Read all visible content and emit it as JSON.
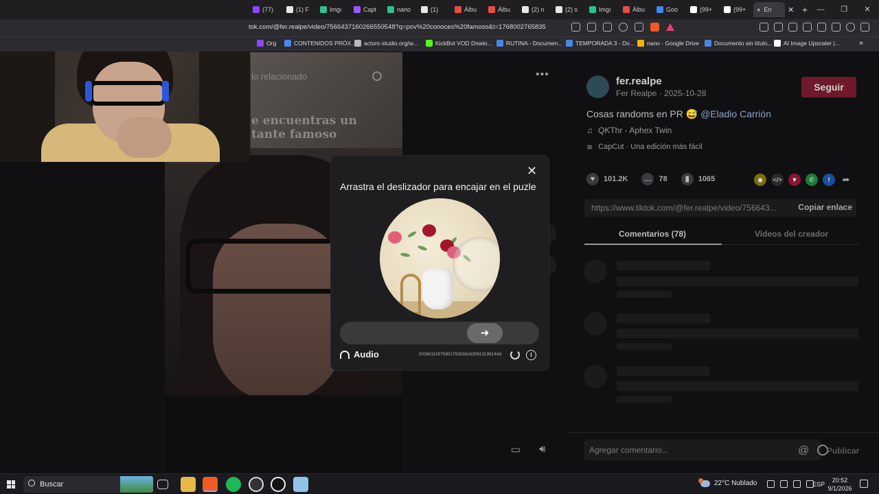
{
  "browser": {
    "tabs": [
      {
        "label": "(77)",
        "color": "#8e44ff"
      },
      {
        "label": "(1) F",
        "color": "#e8e8e8"
      },
      {
        "label": "Imgı",
        "color": "#2fbf8f"
      },
      {
        "label": "Capt",
        "color": "#9b59ff"
      },
      {
        "label": "nano",
        "color": "#2fbf8f"
      },
      {
        "label": "(1)  ",
        "color": "#e8e8e8"
      },
      {
        "label": "Álbu",
        "color": "#e94c3d"
      },
      {
        "label": "Álbu",
        "color": "#e94c3d"
      },
      {
        "label": "(2) n",
        "color": "#e8e8e8"
      },
      {
        "label": "(2) s",
        "color": "#e8e8e8"
      },
      {
        "label": "Imgı",
        "color": "#2fbf8f"
      },
      {
        "label": "Álbu",
        "color": "#e94c3d"
      },
      {
        "label": "Goo",
        "color": "#4285f4"
      },
      {
        "label": "(99+",
        "color": "#ffffff"
      },
      {
        "label": "(99+",
        "color": "#ffffff"
      }
    ],
    "active_tab": "En",
    "url": "tok.com/@fer.realpe/video/7566437160266550548?q=pov%20conoces%20famoso&t=1768002765835",
    "bookmarks": [
      {
        "label": "Org",
        "color": "#8e44ff"
      },
      {
        "label": "CONTENIDOS PRÓX...",
        "color": "#4a86e8"
      },
      {
        "label": "actors-studio.org/w...",
        "color": "#bbbbbb"
      },
      {
        "label": "KickBot VOD Dowlo...",
        "color": "#53fc18"
      },
      {
        "label": "RUTINA - Documen...",
        "color": "#4a86e8"
      },
      {
        "label": "TEMPORADA 3 - Do...",
        "color": "#4a86e8"
      },
      {
        "label": "nano - Google Drive",
        "color": "#f4b400"
      },
      {
        "label": "Documento sin título...",
        "color": "#4a86e8"
      },
      {
        "label": "AI Image Upscaler |...",
        "color": "#ffffff"
      }
    ]
  },
  "video": {
    "related_label": "lo relacionado",
    "overlay_text_1": "e encuentras un",
    "overlay_text_2": "tante famoso"
  },
  "creator": {
    "username": "fer.realpe",
    "meta": "Fer Realpe · 2025-10-28",
    "follow_label": "Seguir",
    "description": "Cosas randoms en PR 😅",
    "mention": "@Eladio Carrión",
    "music": "QKThr - Aphex Twin",
    "capcut": "CapCut · Una edición más fácil"
  },
  "stats": {
    "likes": "101.2K",
    "comments": "78",
    "saves": "1065"
  },
  "share": {
    "link": "https://www.tiktok.com/@fer.realpe/video/756643...",
    "copy_label": "Copiar enlace"
  },
  "panel_tabs": {
    "comments": "Comentarios (78)",
    "creator_videos": "Videos del creador"
  },
  "comment_box": {
    "placeholder": "Agregar comentario...",
    "post_label": "Publicar"
  },
  "captcha": {
    "title": "Arrastra el deslizador para encajar en el puzle",
    "audio_label": "Audio",
    "code": "20260110075901792836162081319914A6",
    "slider_progress": 0.78
  },
  "taskbar": {
    "search_placeholder": "Buscar",
    "weather": "22°C  Nublado",
    "language": "ESP",
    "time": "20:52",
    "date": "9/1/2026"
  }
}
